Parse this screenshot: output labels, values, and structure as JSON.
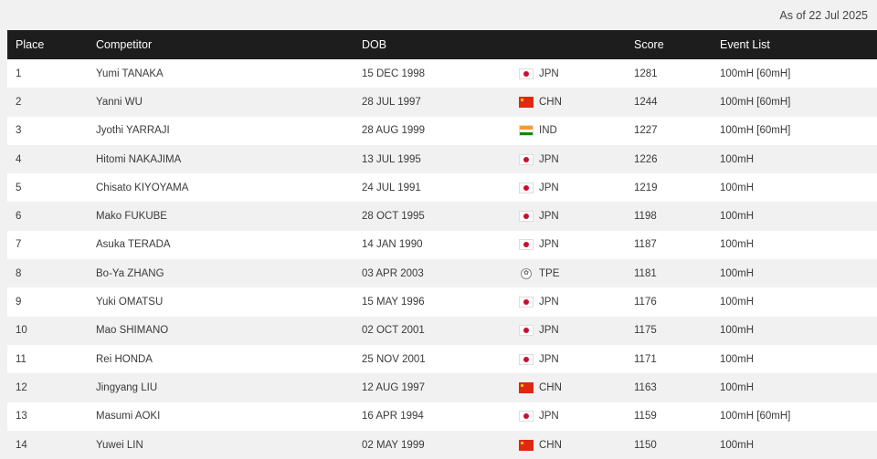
{
  "as_of": "As of 22 Jul 2025",
  "columns": {
    "place": "Place",
    "competitor": "Competitor",
    "dob": "DOB",
    "score": "Score",
    "events": "Event List"
  },
  "rows": [
    {
      "place": "1",
      "competitor": "Yumi TANAKA",
      "dob": "15 DEC 1998",
      "nat": "JPN",
      "flag": "jpn-flag-icon",
      "score": "1281",
      "events": "100mH [60mH]"
    },
    {
      "place": "2",
      "competitor": "Yanni WU",
      "dob": "28 JUL 1997",
      "nat": "CHN",
      "flag": "chn-flag-icon",
      "score": "1244",
      "events": "100mH [60mH]"
    },
    {
      "place": "3",
      "competitor": "Jyothi YARRAJI",
      "dob": "28 AUG 1999",
      "nat": "IND",
      "flag": "ind-flag-icon",
      "score": "1227",
      "events": "100mH [60mH]"
    },
    {
      "place": "4",
      "competitor": "Hitomi NAKAJIMA",
      "dob": "13 JUL 1995",
      "nat": "JPN",
      "flag": "jpn-flag-icon",
      "score": "1226",
      "events": "100mH"
    },
    {
      "place": "5",
      "competitor": "Chisato KIYOYAMA",
      "dob": "24 JUL 1991",
      "nat": "JPN",
      "flag": "jpn-flag-icon",
      "score": "1219",
      "events": "100mH"
    },
    {
      "place": "6",
      "competitor": "Mako FUKUBE",
      "dob": "28 OCT 1995",
      "nat": "JPN",
      "flag": "jpn-flag-icon",
      "score": "1198",
      "events": "100mH"
    },
    {
      "place": "7",
      "competitor": "Asuka TERADA",
      "dob": "14 JAN 1990",
      "nat": "JPN",
      "flag": "jpn-flag-icon",
      "score": "1187",
      "events": "100mH"
    },
    {
      "place": "8",
      "competitor": "Bo-Ya ZHANG",
      "dob": "03 APR 2003",
      "nat": "TPE",
      "flag": "tpe-flag-icon",
      "score": "1181",
      "events": "100mH"
    },
    {
      "place": "9",
      "competitor": "Yuki OMATSU",
      "dob": "15 MAY 1996",
      "nat": "JPN",
      "flag": "jpn-flag-icon",
      "score": "1176",
      "events": "100mH"
    },
    {
      "place": "10",
      "competitor": "Mao SHIMANO",
      "dob": "02 OCT 2001",
      "nat": "JPN",
      "flag": "jpn-flag-icon",
      "score": "1175",
      "events": "100mH"
    },
    {
      "place": "11",
      "competitor": "Rei HONDA",
      "dob": "25 NOV 2001",
      "nat": "JPN",
      "flag": "jpn-flag-icon",
      "score": "1171",
      "events": "100mH"
    },
    {
      "place": "12",
      "competitor": "Jingyang LIU",
      "dob": "12 AUG 1997",
      "nat": "CHN",
      "flag": "chn-flag-icon",
      "score": "1163",
      "events": "100mH"
    },
    {
      "place": "13",
      "competitor": "Masumi AOKI",
      "dob": "16 APR 1994",
      "nat": "JPN",
      "flag": "jpn-flag-icon",
      "score": "1159",
      "events": "100mH [60mH]"
    },
    {
      "place": "14",
      "competitor": "Yuwei LIN",
      "dob": "02 MAY 1999",
      "nat": "CHN",
      "flag": "chn-flag-icon",
      "score": "1150",
      "events": "100mH"
    }
  ]
}
